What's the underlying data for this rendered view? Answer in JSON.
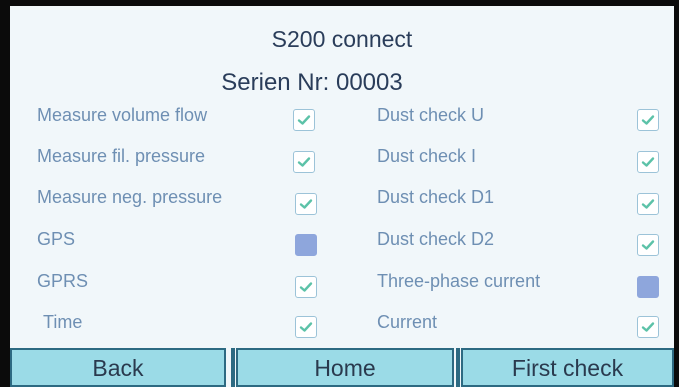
{
  "title": "S200 connect",
  "serial": "Serien Nr: 00003",
  "left_options": [
    {
      "label": "Measure volume flow",
      "checked": true
    },
    {
      "label": "Measure fil. pressure",
      "checked": true
    },
    {
      "label": "Measure neg. pressure",
      "checked": true
    },
    {
      "label": "GPS",
      "checked": false
    },
    {
      "label": "GPRS",
      "checked": true
    },
    {
      "label": "Time",
      "checked": true
    }
  ],
  "right_options": [
    {
      "label": "Dust check U",
      "checked": true
    },
    {
      "label": "Dust check I",
      "checked": true
    },
    {
      "label": "Dust check D1",
      "checked": true
    },
    {
      "label": "Dust check D2",
      "checked": true
    },
    {
      "label": "Three-phase current",
      "checked": false
    },
    {
      "label": "Current",
      "checked": true
    }
  ],
  "buttons": {
    "back": "Back",
    "home": "Home",
    "first_check": "First check"
  },
  "colors": {
    "screen_bg": "#f1f7fa",
    "label": "#6e8fb3",
    "checkmark": "#5cc2a8",
    "unchecked_fill": "#8ea6dc",
    "button_bg": "#9bdbe7"
  }
}
